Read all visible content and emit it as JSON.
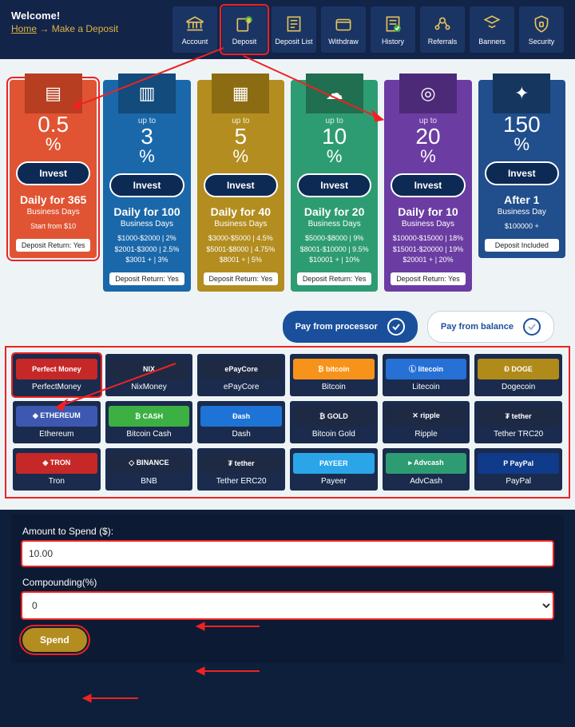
{
  "header": {
    "welcome": "Welcome!",
    "home": "Home",
    "arrow": "→",
    "breadcrumb": "Make a Deposit"
  },
  "nav": [
    {
      "label": "Account"
    },
    {
      "label": "Deposit"
    },
    {
      "label": "Deposit List"
    },
    {
      "label": "Withdraw"
    },
    {
      "label": "History"
    },
    {
      "label": "Referrals"
    },
    {
      "label": "Banners"
    },
    {
      "label": "Security"
    }
  ],
  "plans": [
    {
      "upto": "",
      "rate": "0.5",
      "pct": "%",
      "invest": "Invest",
      "title": "Daily for 365",
      "sub": "Business Days",
      "tiers": [
        "Start from $10"
      ],
      "ret": "Deposit Return: Yes"
    },
    {
      "upto": "up to",
      "rate": "3",
      "pct": "%",
      "invest": "Invest",
      "title": "Daily for 100",
      "sub": "Business Days",
      "tiers": [
        "$1000-$2000 | 2%",
        "$2001-$3000 | 2.5%",
        "$3001 + | 3%"
      ],
      "ret": "Deposit Return: Yes"
    },
    {
      "upto": "up to",
      "rate": "5",
      "pct": "%",
      "invest": "Invest",
      "title": "Daily for 40",
      "sub": "Business Days",
      "tiers": [
        "$3000-$5000 | 4.5%",
        "$5001-$8000 | 4.75%",
        "$8001 + | 5%"
      ],
      "ret": "Deposit Return: Yes"
    },
    {
      "upto": "up to",
      "rate": "10",
      "pct": "%",
      "invest": "Invest",
      "title": "Daily for 20",
      "sub": "Business Days",
      "tiers": [
        "$5000-$8000 | 9%",
        "$8001-$10000 | 9.5%",
        "$10001 + | 10%"
      ],
      "ret": "Deposit Return: Yes"
    },
    {
      "upto": "up to",
      "rate": "20",
      "pct": "%",
      "invest": "Invest",
      "title": "Daily for 10",
      "sub": "Business Days",
      "tiers": [
        "$10000-$15000 | 18%",
        "$15001-$20000 | 19%",
        "$20001 + | 20%"
      ],
      "ret": "Deposit Return: Yes"
    },
    {
      "upto": "",
      "rate": "150",
      "pct": "%",
      "invest": "Invest",
      "title": "After 1",
      "sub": "Business Day",
      "tiers": [
        "$100000 +"
      ],
      "ret": "Deposit Included"
    }
  ],
  "pay_tabs": {
    "processor": "Pay from processor",
    "balance": "Pay from balance"
  },
  "processors": [
    {
      "label": "PerfectMoney",
      "bg": "#c62828",
      "txt": "Perfect Money"
    },
    {
      "label": "NixMoney",
      "bg": "#1e2a44",
      "txt": "NIX"
    },
    {
      "label": "ePayCore",
      "bg": "#1e2a44",
      "txt": "ePayCore"
    },
    {
      "label": "Bitcoin",
      "bg": "#f7931a",
      "txt": "₿ bitcoin"
    },
    {
      "label": "Litecoin",
      "bg": "#2670d6",
      "txt": "Ⓛ litecoin"
    },
    {
      "label": "Dogecoin",
      "bg": "#b08b1a",
      "txt": "Ð DOGE"
    },
    {
      "label": "Ethereum",
      "bg": "#3d58b0",
      "txt": "◆ ETHEREUM"
    },
    {
      "label": "Bitcoin Cash",
      "bg": "#3cb043",
      "txt": "₿ CASH"
    },
    {
      "label": "Dash",
      "bg": "#1e73d6",
      "txt": "Ðash"
    },
    {
      "label": "Bitcoin Gold",
      "bg": "#1e2a44",
      "txt": "₿ GOLD"
    },
    {
      "label": "Ripple",
      "bg": "#1e2a44",
      "txt": "✕ ripple"
    },
    {
      "label": "Tether TRC20",
      "bg": "#1e2a44",
      "txt": "₮ tether"
    },
    {
      "label": "Tron",
      "bg": "#c62828",
      "txt": "◈ TRON"
    },
    {
      "label": "BNB",
      "bg": "#1e2a44",
      "txt": "◇ BINANCE"
    },
    {
      "label": "Tether ERC20",
      "bg": "#1e2a44",
      "txt": "₮ tether"
    },
    {
      "label": "Payeer",
      "bg": "#2aa6e8",
      "txt": "PAYEER"
    },
    {
      "label": "AdvCash",
      "bg": "#2e9c72",
      "txt": "▸ Advcash"
    },
    {
      "label": "PayPal",
      "bg": "#103a8a",
      "txt": "P PayPal"
    }
  ],
  "form": {
    "amount_label": "Amount to Spend ($):",
    "amount_value": "10.00",
    "comp_label": "Compounding(%)",
    "comp_value": "0",
    "spend": "Spend"
  }
}
